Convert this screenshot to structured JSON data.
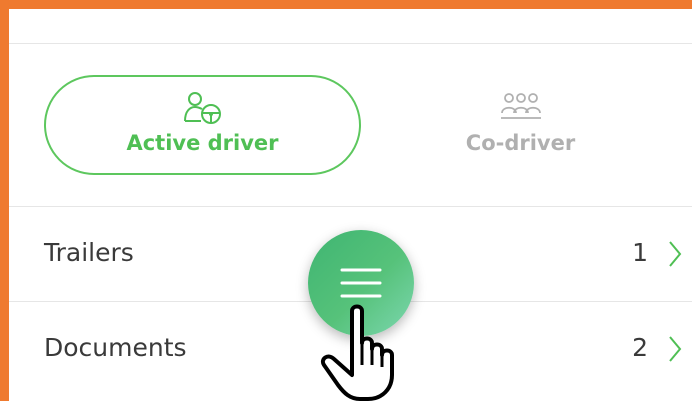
{
  "colors": {
    "frame": "#ef7a2f",
    "accent": "#4fbf54",
    "inactive": "#b0b0b0",
    "text": "#3a3a3a"
  },
  "mode_toggle": {
    "active": {
      "label": "Active driver",
      "icon": "driver-wheel-icon"
    },
    "inactive": {
      "label": "Co-driver",
      "icon": "group-people-icon"
    }
  },
  "list": [
    {
      "label": "Trailers",
      "count": "1"
    },
    {
      "label": "Documents",
      "count": "2"
    }
  ],
  "fab": {
    "icon": "menu-icon"
  },
  "cursor": {
    "icon": "hand-pointer-icon"
  }
}
